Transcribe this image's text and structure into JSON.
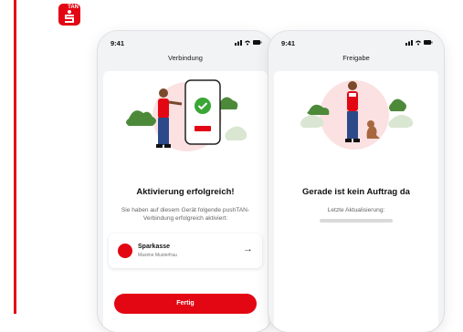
{
  "app": {
    "icon_badge": "TAN",
    "icon_name": "sparkasse-s-icon"
  },
  "phones": [
    {
      "status_time": "9:41",
      "title": "Verbindung",
      "headline": "Aktivierung erfolgreich!",
      "subtext": "Sie haben auf diesem Gerät folgende pushTAN-Verbindung erfolgreich aktiviert:",
      "bank": {
        "name": "Sparkasse",
        "owner": "Maxime Musterfrau",
        "arrow": "→"
      },
      "button_label": "Fertig"
    },
    {
      "status_time": "9:41",
      "title": "Freigabe",
      "headline": "Gerade ist kein Auftrag da",
      "subtext": "Letzte Aktualisierung:"
    }
  ],
  "colors": {
    "brand_red": "#e30613",
    "green_check": "#3aa635"
  }
}
